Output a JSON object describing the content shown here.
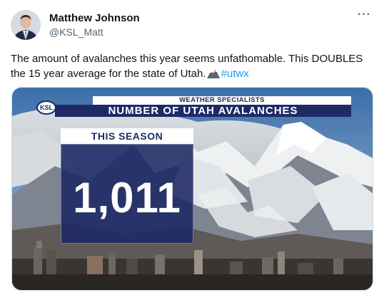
{
  "author": {
    "name": "Matthew Johnson",
    "handle": "@KSL_Matt"
  },
  "menu_icon": "more-horizontal-icon",
  "tweet": {
    "text_before": "The amount of avalanches this year seems unfathomable. This DOUBLES the 15 year average for the state of Utah.",
    "emoji": "mountain-emoji",
    "hashtag": "#utwx"
  },
  "graphic": {
    "logo": "KSL",
    "subtitle": "WEATHER SPECIALISTS",
    "title": "NUMBER OF UTAH AVALANCHES",
    "season_label": "THIS SEASON",
    "season_value": "1,011"
  }
}
